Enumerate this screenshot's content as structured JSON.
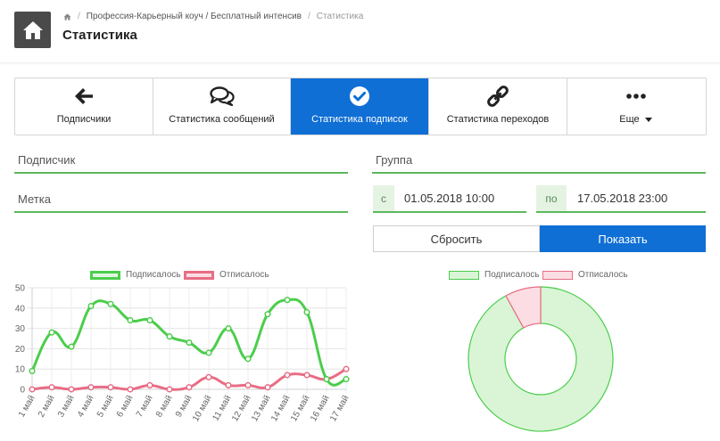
{
  "header": {
    "breadcrumb": {
      "home_icon": "home-icon",
      "item1": "Профессия-Карьерный коуч / Бесплатный интенсив",
      "item2": "Статистика"
    },
    "title": "Статистика"
  },
  "tabs": [
    {
      "label": "Подписчики",
      "icon": "arrow-left-icon"
    },
    {
      "label": "Статистика сообщений",
      "icon": "comments-icon"
    },
    {
      "label": "Статистика подписок",
      "icon": "check-circle-icon",
      "active": true
    },
    {
      "label": "Статистика переходов",
      "icon": "link-icon"
    },
    {
      "label": "Еще",
      "icon": "ellipsis-icon"
    }
  ],
  "filters": {
    "subscriber_placeholder": "Подписчик",
    "tag_placeholder": "Метка",
    "group_placeholder": "Группа",
    "from_prefix": "с",
    "from_value": "01.05.2018 10:00",
    "to_prefix": "по",
    "to_value": "17.05.2018 23:00",
    "reset_label": "Сбросить",
    "show_label": "Показать"
  },
  "colors": {
    "accent": "#0f6fd5",
    "subscribed": "#4ccd4c",
    "unsubscribed": "#e86d85",
    "field_line": "#5cb85c"
  },
  "chart_data": [
    {
      "type": "line",
      "categories": [
        "1 май",
        "2 май",
        "3 май",
        "4 май",
        "5 май",
        "6 май",
        "7 май",
        "8 май",
        "9 май",
        "10 май",
        "11 май",
        "12 май",
        "13 май",
        "14 май",
        "15 май",
        "16 май",
        "17 май"
      ],
      "series": [
        {
          "name": "Подписалось",
          "color": "#4ccd4c",
          "values": [
            9,
            28,
            21,
            41,
            42,
            34,
            34,
            26,
            23,
            18,
            30,
            15,
            37,
            44,
            38,
            5,
            5
          ]
        },
        {
          "name": "Отписалось",
          "color": "#e86d85",
          "values": [
            0,
            1,
            0,
            1,
            1,
            0,
            2,
            0,
            1,
            6,
            2,
            2,
            1,
            7,
            7,
            5,
            10
          ]
        }
      ],
      "yticks": [
        0,
        10,
        20,
        30,
        40,
        50
      ],
      "ylim": [
        0,
        50
      ],
      "grid": true,
      "legend": "top"
    },
    {
      "type": "pie",
      "labels": [
        "Подписалось",
        "Отписалось"
      ],
      "values": [
        92,
        8
      ],
      "colors": [
        "#d9f5d6",
        "#fbdde3"
      ],
      "border_colors": [
        "#4ccd4c",
        "#e86d85"
      ],
      "legend": "top"
    }
  ]
}
